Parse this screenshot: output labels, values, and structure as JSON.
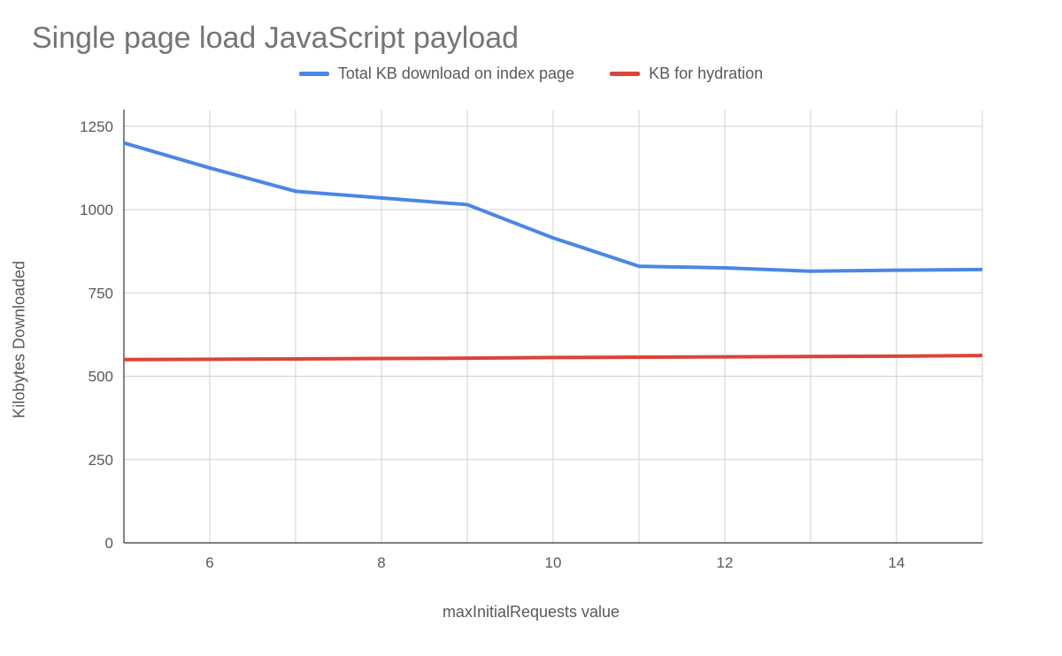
{
  "chart_data": {
    "type": "line",
    "title": "Single page load JavaScript payload",
    "xlabel": "maxInitialRequests value",
    "ylabel": "Kilobytes Downloaded",
    "x": [
      5,
      6,
      7,
      8,
      9,
      10,
      11,
      12,
      13,
      14,
      15
    ],
    "series": [
      {
        "name": "Total KB download on index page",
        "values": [
          1200,
          1125,
          1055,
          1035,
          1015,
          915,
          830,
          825,
          815,
          818,
          820
        ],
        "color": "#4a86e8"
      },
      {
        "name": "KB for hydration",
        "values": [
          550,
          551,
          552,
          553,
          554,
          556,
          557,
          558,
          559,
          560,
          562
        ],
        "color": "#db4437"
      }
    ],
    "xlim": [
      5,
      15
    ],
    "ylim": [
      0,
      1300
    ],
    "yticks": [
      0,
      250,
      500,
      750,
      1000,
      1250
    ],
    "xticks": [
      6,
      8,
      10,
      12,
      14
    ]
  }
}
